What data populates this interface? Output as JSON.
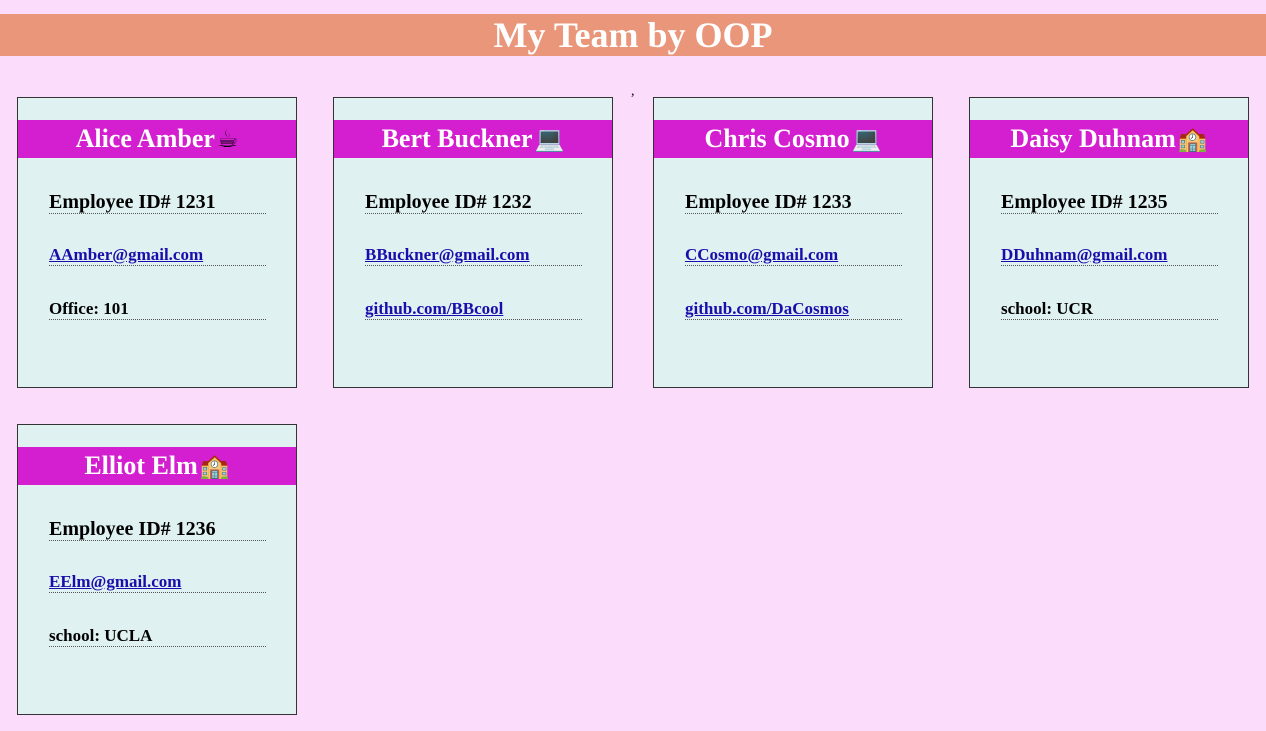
{
  "header": {
    "title": "My Team by OOP"
  },
  "stray_mark": ",",
  "employees": [
    {
      "name": "Alice Amber",
      "emoji": "☕",
      "icon": "coffee-icon",
      "id": "Employee ID# 1231",
      "email": "AAmber@gmail.com",
      "extra": "Office: 101",
      "extra_is_link": false
    },
    {
      "name": "Bert Buckner",
      "emoji": "💻",
      "icon": "laptop-icon",
      "id": "Employee ID# 1232",
      "email": "BBuckner@gmail.com",
      "extra": "github.com/BBcool",
      "extra_is_link": true
    },
    {
      "name": "Chris Cosmo",
      "emoji": "💻",
      "icon": "laptop-icon",
      "id": "Employee ID# 1233",
      "email": "CCosmo@gmail.com",
      "extra": "github.com/DaCosmos",
      "extra_is_link": true
    },
    {
      "name": "Daisy Duhnam",
      "emoji": "🏫",
      "icon": "school-icon",
      "id": "Employee ID# 1235",
      "email": "DDuhnam@gmail.com",
      "extra": "school: UCR",
      "extra_is_link": false
    },
    {
      "name": "Elliot Elm",
      "emoji": "🏫",
      "icon": "school-icon",
      "id": "Employee ID# 1236",
      "email": "EElm@gmail.com",
      "extra": "school: UCLA",
      "extra_is_link": false
    }
  ],
  "colors": {
    "page_bg": "#fbdcfb",
    "header_bg": "#e9967a",
    "card_bg": "#dff1f1",
    "card_header_bg": "#d31fcf",
    "link": "#1a0dab"
  }
}
